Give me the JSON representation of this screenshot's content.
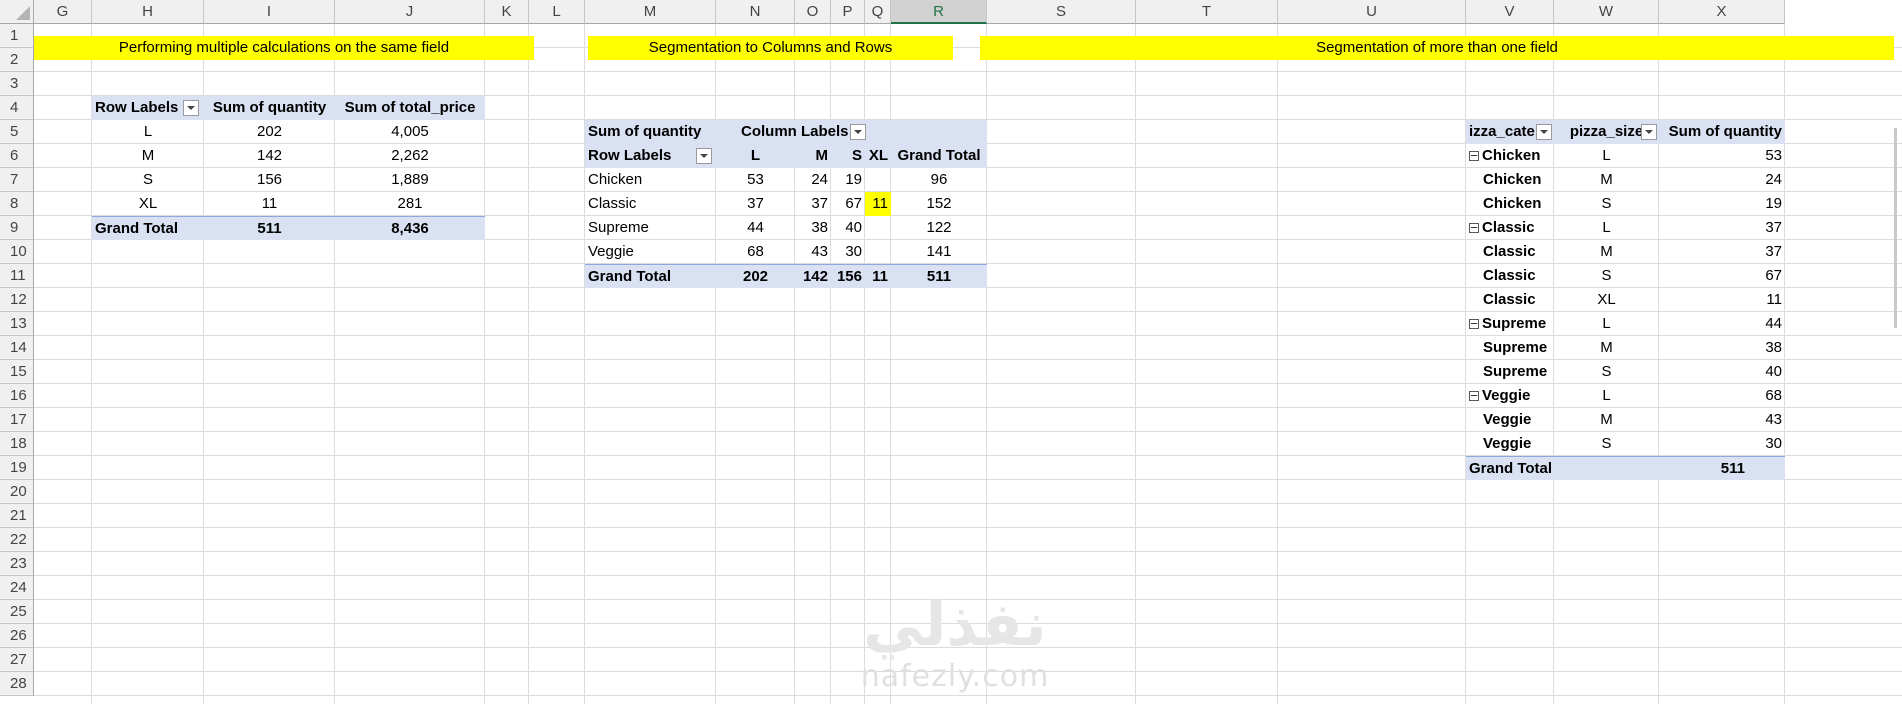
{
  "columns": [
    "G",
    "H",
    "I",
    "J",
    "K",
    "L",
    "M",
    "N",
    "O",
    "P",
    "Q",
    "R",
    "S",
    "T",
    "U",
    "V",
    "W",
    "X"
  ],
  "selected_column": "R",
  "rows": [
    "1",
    "2",
    "3",
    "4",
    "5",
    "6",
    "7",
    "8",
    "9",
    "10",
    "11",
    "12",
    "13",
    "14",
    "15",
    "16",
    "17",
    "18",
    "19",
    "20",
    "21",
    "22",
    "23",
    "24",
    "25",
    "26",
    "27",
    "28"
  ],
  "titles": {
    "t1": "Performing multiple calculations on the same field",
    "t2": "Segmentation to Columns and Rows",
    "t3": "Segmentation of more than one field"
  },
  "pivot1": {
    "headers": [
      "Row Labels",
      "Sum of quantity",
      "Sum of total_price"
    ],
    "rows": [
      [
        "L",
        "202",
        "4,005"
      ],
      [
        "M",
        "142",
        "2,262"
      ],
      [
        "S",
        "156",
        "1,889"
      ],
      [
        "XL",
        "11",
        "281"
      ]
    ],
    "total": [
      "Grand Total",
      "511",
      "8,436"
    ]
  },
  "pivot2": {
    "corner": "Sum of quantity",
    "col_labels": "Column Labels",
    "row_labels": "Row Labels",
    "col_headers": [
      "L",
      "M",
      "S",
      "XL",
      "Grand Total"
    ],
    "rows": [
      [
        "Chicken",
        "53",
        "24",
        "19",
        "",
        "96"
      ],
      [
        "Classic",
        "37",
        "37",
        "67",
        "11",
        "152"
      ],
      [
        "Supreme",
        "44",
        "38",
        "40",
        "",
        "122"
      ],
      [
        "Veggie",
        "68",
        "43",
        "30",
        "",
        "141"
      ]
    ],
    "total": [
      "Grand Total",
      "202",
      "142",
      "156",
      "11",
      "511"
    ]
  },
  "pivot3": {
    "headers": [
      "izza_cate",
      "pizza_size",
      "Sum of quantity"
    ],
    "rows": [
      [
        "Chicken",
        "L",
        "53",
        "group"
      ],
      [
        "Chicken",
        "M",
        "24",
        "item"
      ],
      [
        "Chicken",
        "S",
        "19",
        "item"
      ],
      [
        "Classic",
        "L",
        "37",
        "group"
      ],
      [
        "Classic",
        "M",
        "37",
        "item"
      ],
      [
        "Classic",
        "S",
        "67",
        "item"
      ],
      [
        "Classic",
        "XL",
        "11",
        "item"
      ],
      [
        "Supreme",
        "L",
        "44",
        "group"
      ],
      [
        "Supreme",
        "M",
        "38",
        "item"
      ],
      [
        "Supreme",
        "S",
        "40",
        "item"
      ],
      [
        "Veggie",
        "L",
        "68",
        "group"
      ],
      [
        "Veggie",
        "M",
        "43",
        "item"
      ],
      [
        "Veggie",
        "S",
        "30",
        "item"
      ]
    ],
    "total": [
      "Grand Total",
      "511"
    ]
  },
  "watermark": {
    "arabic": "نفذلي",
    "latin": "nafezly.com"
  },
  "colors": {
    "yellow": "#ffff00",
    "pivot_band": "#d9e1f2",
    "selected_header": "#217346"
  }
}
